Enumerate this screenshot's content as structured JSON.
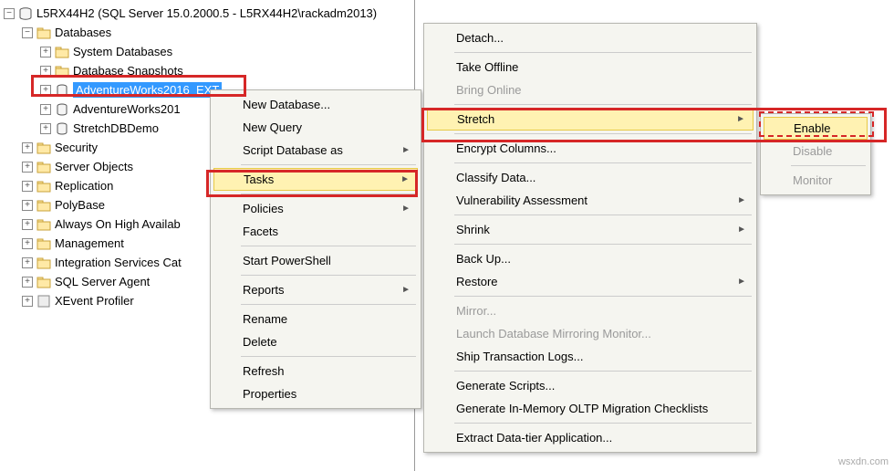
{
  "tree": {
    "server": "L5RX44H2 (SQL Server 15.0.2000.5 - L5RX44H2\\rackadm2013)",
    "databases": "Databases",
    "sysdb": "System Databases",
    "snapshots": "Database Snapshots",
    "aw2016ext": "AdventureWorks2016_EXT",
    "aw201": "AdventureWorks201",
    "stretchdemo": "StretchDBDemo",
    "security": "Security",
    "serverobjects": "Server Objects",
    "replication": "Replication",
    "polybase": "PolyBase",
    "alwayson": "Always On High Availab",
    "management": "Management",
    "intsvc": "Integration Services Cat",
    "agent": "SQL Server Agent",
    "xevent": "XEvent Profiler"
  },
  "menu1": {
    "new_db": "New Database...",
    "new_query": "New Query",
    "script_db": "Script Database as",
    "tasks": "Tasks",
    "policies": "Policies",
    "facets": "Facets",
    "start_ps": "Start PowerShell",
    "reports": "Reports",
    "rename": "Rename",
    "delete": "Delete",
    "refresh": "Refresh",
    "properties": "Properties"
  },
  "menu2": {
    "detach": "Detach...",
    "take_offline": "Take Offline",
    "bring_online": "Bring Online",
    "stretch": "Stretch",
    "encrypt": "Encrypt Columns...",
    "classify": "Classify Data...",
    "vuln": "Vulnerability Assessment",
    "shrink": "Shrink",
    "backup": "Back Up...",
    "restore": "Restore",
    "mirror": "Mirror...",
    "launch_mirror": "Launch Database Mirroring Monitor...",
    "ship_logs": "Ship Transaction Logs...",
    "gen_scripts": "Generate Scripts...",
    "gen_oltp": "Generate In-Memory OLTP Migration Checklists",
    "extract_dac": "Extract Data-tier Application..."
  },
  "menu3": {
    "enable": "Enable",
    "disable": "Disable",
    "monitor": "Monitor"
  },
  "watermark": "wsxdn.com"
}
